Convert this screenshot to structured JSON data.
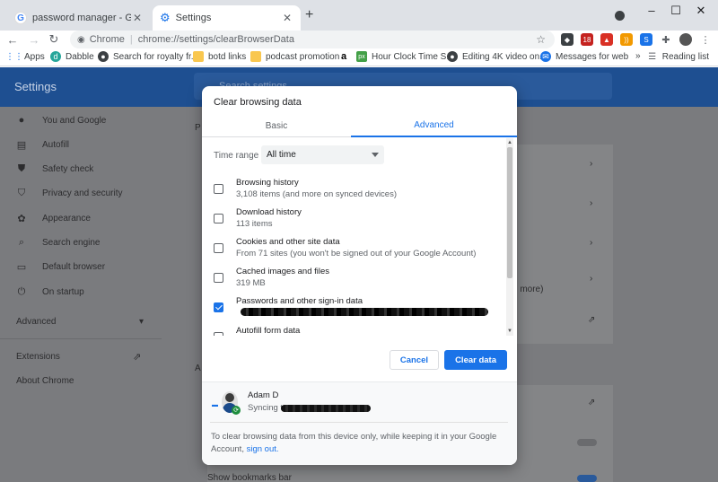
{
  "tabs": [
    {
      "title": "password manager - Google Sea",
      "close": "✕"
    },
    {
      "title": "Settings",
      "close": "✕"
    }
  ],
  "newtab": "+",
  "window": {
    "minimize": "–",
    "maximize": "☐",
    "close": "✕"
  },
  "omnibox": {
    "scheme": "Chrome",
    "separator": "|",
    "url": "chrome://settings/clearBrowserData"
  },
  "bookmarks": [
    {
      "label": "Apps",
      "icon": "apps-grid-icon"
    },
    {
      "label": "Dabble",
      "icon": "dabble-icon"
    },
    {
      "label": "Search for royalty fr...",
      "icon": "globe-icon"
    },
    {
      "label": "botd links",
      "icon": "folder-icon"
    },
    {
      "label": "podcast promotion",
      "icon": "folder-icon"
    },
    {
      "label": "Hour Clock Time S...",
      "icon": "px-icon"
    },
    {
      "label": "Editing 4K video on...",
      "icon": "globe-icon"
    },
    {
      "label": "Messages for web",
      "icon": "messages-icon"
    }
  ],
  "bookmarks_more": "»",
  "reading_list": "Reading list",
  "settings": {
    "title": "Settings",
    "search_placeholder": "Search settings",
    "sidebar": [
      {
        "label": "You and Google",
        "icon": "person-icon"
      },
      {
        "label": "Autofill",
        "icon": "clipboard-icon"
      },
      {
        "label": "Safety check",
        "icon": "shield-check-icon"
      },
      {
        "label": "Privacy and security",
        "icon": "shield-icon"
      },
      {
        "label": "Appearance",
        "icon": "palette-icon"
      },
      {
        "label": "Search engine",
        "icon": "search-icon"
      },
      {
        "label": "Default browser",
        "icon": "browser-icon"
      },
      {
        "label": "On startup",
        "icon": "power-icon"
      }
    ],
    "advanced": "Advanced",
    "extensions": "Extensions",
    "about": "About Chrome",
    "bg_letters": {
      "p": "P",
      "a": "A"
    },
    "bg_more": "d more)",
    "bg_bookmarks_bar": "Show bookmarks bar"
  },
  "dialog": {
    "title": "Clear browsing data",
    "tab_basic": "Basic",
    "tab_advanced": "Advanced",
    "time_range_label": "Time range",
    "time_range_value": "All time",
    "items": [
      {
        "label": "Browsing history",
        "sub": "3,108 items (and more on synced devices)",
        "checked": false
      },
      {
        "label": "Download history",
        "sub": "113 items",
        "checked": false
      },
      {
        "label": "Cookies and other site data",
        "sub": "From 71 sites (you won't be signed out of your Google Account)",
        "checked": false
      },
      {
        "label": "Cached images and files",
        "sub": "319 MB",
        "checked": false
      },
      {
        "label": "Passwords and other sign-in data",
        "sub": "",
        "checked": true
      },
      {
        "label": "Autofill form data",
        "sub": "",
        "checked": false
      }
    ],
    "cancel": "Cancel",
    "clear": "Clear data",
    "account_name": "Adam D",
    "syncing": "Syncing to",
    "info_text": "To clear browsing data from this device only, while keeping it in your Google Account,",
    "sign_out": "sign out."
  },
  "colors": {
    "accent": "#1a73e8",
    "header": "#1e4f91",
    "overlay": "#7a7b7e"
  }
}
